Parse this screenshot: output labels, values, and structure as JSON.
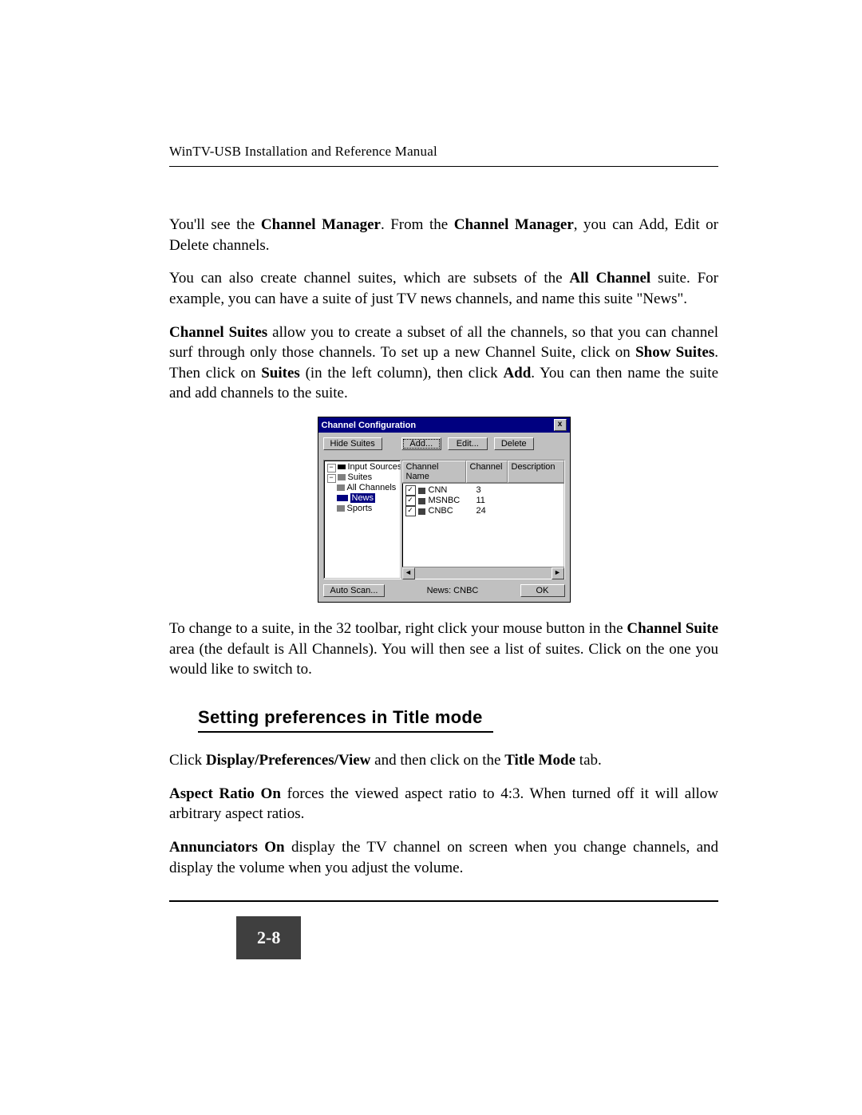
{
  "header": {
    "product": "WinTV-USB",
    "rest": " Installation and Reference Manual"
  },
  "para1_a": "You'll see the ",
  "para1_b": "Channel Manager",
  "para1_c": ". From the ",
  "para1_d": "Channel Manager",
  "para1_e": ", you can Add, Edit or Delete channels.",
  "para2_a": "You can also create channel suites, which are subsets of the ",
  "para2_b": "All Channel",
  "para2_c": " suite. For example, you can have a suite of just TV news channels, and name this suite \"News\".",
  "para3_a": "Channel Suites",
  "para3_b": " allow you to create a subset of all the channels, so that you can channel surf through only those channels. To set up a new Channel Suite, click on ",
  "para3_c": "Show Suites",
  "para3_d": ". Then click on ",
  "para3_e": "Suites",
  "para3_f": " (in the left column), then click ",
  "para3_g": "Add",
  "para3_h": ". You can then name the suite and add channels to the suite.",
  "para4_a": "To change to a suite, in the 32 toolbar, right click your mouse button in the ",
  "para4_b": "Channel Suite",
  "para4_c": " area (the default is All Channels). You will then see a list of suites. Click on the one you would like to switch to.",
  "section_heading": "Setting preferences in Title mode",
  "para5_a": "Click ",
  "para5_b": "Display/Preferences/View",
  "para5_c": " and then click on the ",
  "para5_d": "Title Mode",
  "para5_e": " tab.",
  "para6_a": "Aspect Ratio On",
  "para6_b": " forces the viewed aspect ratio to 4:3. When turned off it will allow arbitrary aspect ratios.",
  "para7_a": "Annunciators On",
  "para7_b": " display the TV channel on screen when you change channels, and display the volume when you adjust the volume.",
  "page_number": "2-8",
  "dialog": {
    "title": "Channel Configuration",
    "close_x": "x",
    "hide_suites": "Hide Suites",
    "add": "Add...",
    "edit": "Edit...",
    "delete": "Delete",
    "tree": {
      "input_sources": "Input Sources",
      "suites": "Suites",
      "all_channels": "All Channels",
      "news": "News",
      "sports": "Sports",
      "exp_minus": "−"
    },
    "columns": {
      "name": "Channel Name",
      "channel": "Channel",
      "description": "Description"
    },
    "rows": [
      {
        "check": "✓",
        "name": "CNN",
        "channel": "3"
      },
      {
        "check": "✓",
        "name": "MSNBC",
        "channel": "11"
      },
      {
        "check": "✓",
        "name": "CNBC",
        "channel": "24"
      }
    ],
    "scroll_left": "◄",
    "scroll_right": "►",
    "auto_scan": "Auto Scan...",
    "status": "News:  CNBC",
    "ok": "OK"
  }
}
